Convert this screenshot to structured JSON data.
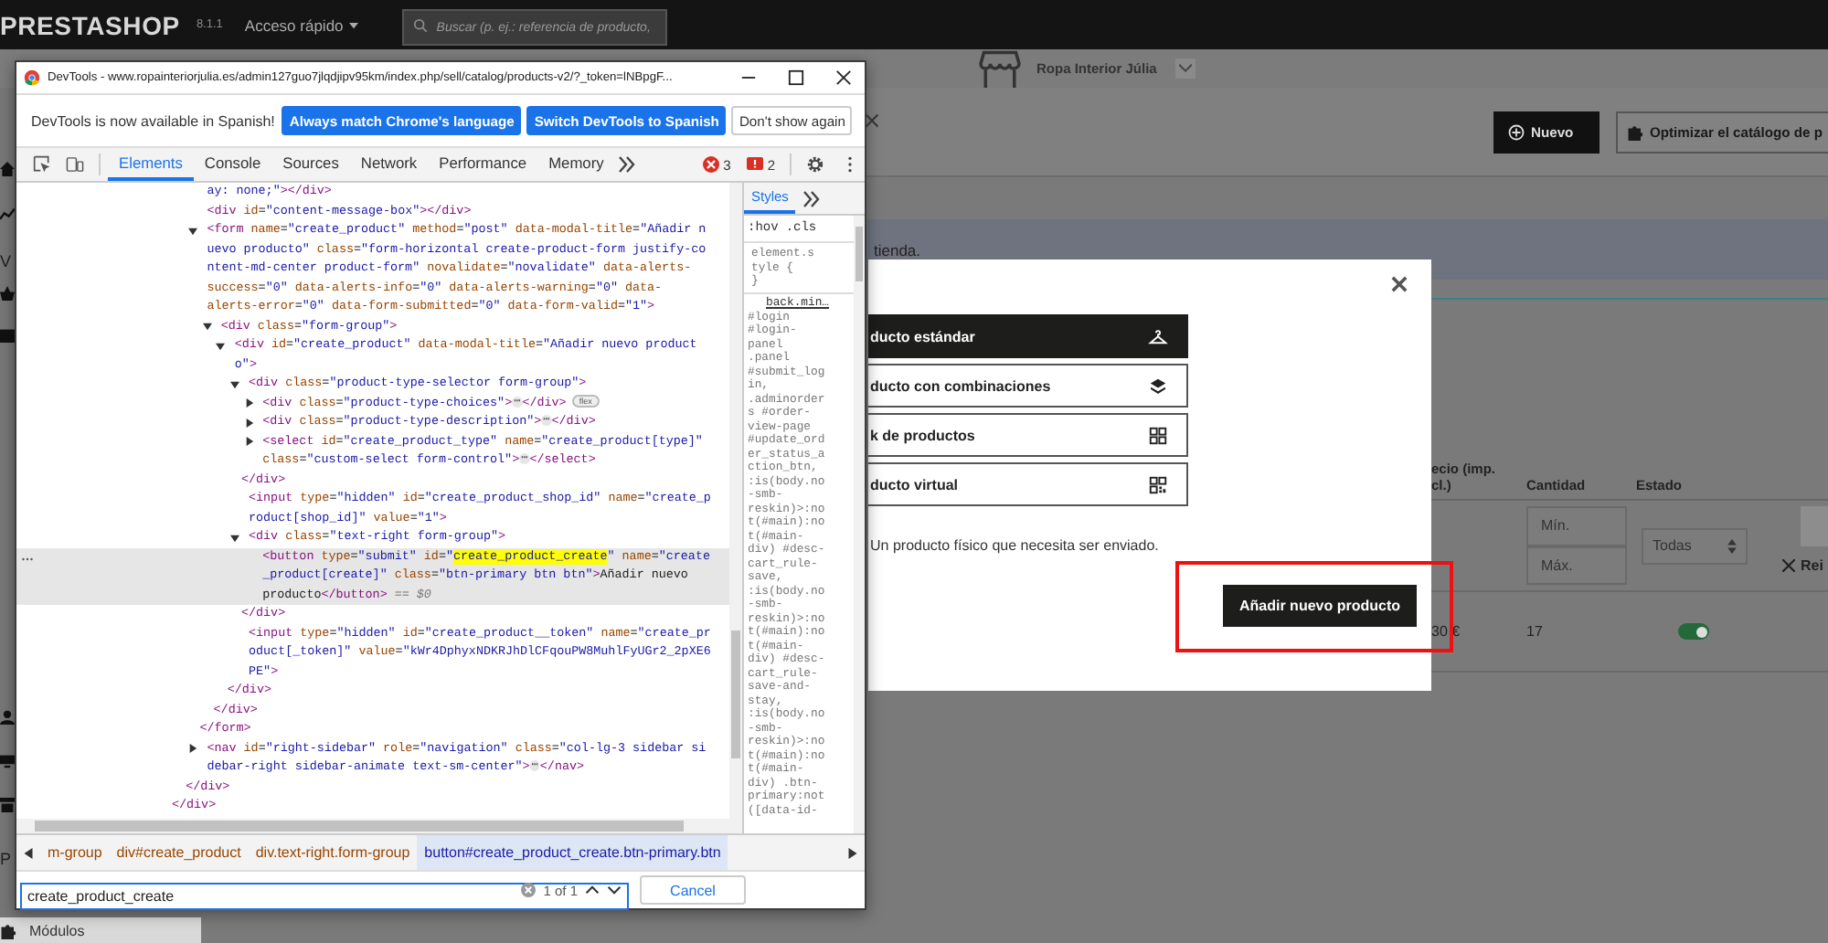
{
  "page": {
    "topbar": {
      "logo": "PRESTASHOP",
      "version": "8.1.1",
      "quick_access": "Acceso rápido",
      "search": {
        "placeholder": "Buscar (p. ej.: referencia de producto,"
      }
    },
    "shop_bar": {
      "shop_name": "Ropa Interior Júlia"
    },
    "sidebar": {
      "labels": [
        "V",
        "P"
      ],
      "bottom_item": "Módulos"
    },
    "toolbar": {
      "buttons": [
        {
          "label": "Nuevo",
          "kind": "primary"
        },
        {
          "label": "Optimizar el catálogo de p",
          "kind": "secondary"
        }
      ]
    },
    "notice": "tienda.",
    "table": {
      "columns": [
        {
          "lines": [
            "ecio (imp.",
            "cl.)"
          ]
        },
        {
          "lines": [
            "Cantidad"
          ]
        },
        {
          "lines": [
            "Estado"
          ]
        }
      ],
      "filters": {
        "min": {
          "placeholder": "Mín."
        },
        "max": {
          "placeholder": "Máx."
        },
        "status": "Todas",
        "reset": "Rei"
      },
      "rows": [
        {
          "price": "30 €",
          "quantity": "17",
          "active": true
        }
      ]
    }
  },
  "devtools": {
    "title": "DevTools - www.ropainteriorjulia.es/admin127guo7jlqdjipv95km/index.php/sell/catalog/products-v2/?_token=lNBpgF...",
    "infobar": {
      "message": "DevTools is now available in Spanish!",
      "buttons": [
        {
          "label": "Always match Chrome's language",
          "kind": "primary"
        },
        {
          "label": "Switch DevTools to Spanish",
          "kind": "primary"
        },
        {
          "label": "Don't show again",
          "kind": "plain"
        }
      ]
    },
    "tabs": [
      {
        "label": "Elements",
        "selected": true
      },
      {
        "label": "Console",
        "selected": false
      },
      {
        "label": "Sources",
        "selected": false
      },
      {
        "label": "Network",
        "selected": false
      },
      {
        "label": "Performance",
        "selected": false
      },
      {
        "label": "Memory",
        "selected": false
      }
    ],
    "errors": "3",
    "warnings": "2",
    "elements": {
      "tree": [
        {
          "close": "</div>",
          "children": [
            {
              "close": "</div>",
              "children": [
                {
                  "selected": false,
                  "lines": [
                    [
                      {
                        "text": "ay: none;\"",
                        "kind": "value"
                      },
                      "></div>"
                    ]
                  ]
                },
                {
                  "selected": false,
                  "lines": [
                    [
                      "<div id=\"content-message-box\"></div>"
                    ]
                  ]
                },
                {
                  "expanded": true,
                  "selected": false,
                  "close": "</form>",
                  "lines": [
                    [
                      "<form name=\"create_product\" method=\"post\" data-modal-title=\"Añadir n"
                    ],
                    [
                      "uevo producto\" class=\"form-horizontal create-product-form justify-co"
                    ],
                    [
                      "ntent-md-center product-form\" novalidate=\"novalidate\" data-alerts-"
                    ],
                    [
                      "success=\"0\" data-alerts-info=\"0\" data-alerts-warning=\"0\" data-"
                    ],
                    [
                      "alerts-error=\"0\" data-form-submitted=\"0\" data-form-valid=\"1\">"
                    ]
                  ],
                  "children": [
                    {
                      "expanded": true,
                      "selected": false,
                      "close": "</div>",
                      "lines": [
                        [
                          "<div class=\"form-group\">"
                        ]
                      ],
                      "children": [
                        {
                          "expanded": true,
                          "selected": false,
                          "close": "</div>",
                          "lines": [
                            [
                              "<div id=\"create_product\" data-modal-title=\"Añadir nuevo product"
                            ],
                            [
                              "o\">"
                            ]
                          ],
                          "children": [
                            {
                              "expanded": true,
                              "selected": false,
                              "close": "</div>",
                              "lines": [
                                [
                                  "<div class=\"product-type-selector form-group\">"
                                ]
                              ],
                              "children": [
                                {
                                  "expanded": false,
                                  "selected": false,
                                  "lines": [
                                    [
                                      "<div class=\"product-type-choices\">",
                                      {
                                        "text": "⋯",
                                        "kind": "ellipsis"
                                      },
                                      "</div>",
                                      {
                                        "text": "flex",
                                        "kind": "badge"
                                      }
                                    ]
                                  ]
                                },
                                {
                                  "expanded": false,
                                  "selected": false,
                                  "lines": [
                                    [
                                      "<div class=\"product-type-description\">",
                                      {
                                        "text": "⋯",
                                        "kind": "ellipsis"
                                      },
                                      "</div>"
                                    ]
                                  ]
                                },
                                {
                                  "expanded": false,
                                  "selected": false,
                                  "lines": [
                                    [
                                      "<select id=\"create_product_type\" name=\"create_product[type]\""
                                    ],
                                    [
                                      "class=\"custom-select form-control\">",
                                      {
                                        "text": "⋯",
                                        "kind": "ellipsis"
                                      },
                                      "</select>"
                                    ]
                                  ]
                                }
                              ]
                            },
                            {
                              "selected": false,
                              "lines": [
                                [
                                  "<input type=\"hidden\" id=\"create_product_shop_id\" name=\"create_p"
                                ],
                                [
                                  "roduct[shop_id]\" value=\"1\">"
                                ]
                              ]
                            },
                            {
                              "expanded": true,
                              "selected": false,
                              "close": "</div>",
                              "lines": [
                                [
                                  "<div class=\"text-right form-group\">"
                                ]
                              ],
                              "children": [
                                {
                                  "selected": true,
                                  "lines": [
                                    [
                                      "<button type=\"submit\" id=\"",
                                      {
                                        "text": "create_product_create",
                                        "kind": "match"
                                      },
                                      "\" name=\"create"
                                    ],
                                    [
                                      "_product[create]\" class=\"btn-primary btn btn\">Añadir nuevo"
                                    ],
                                    [
                                      "producto</button>",
                                      {
                                        "text": " == $0",
                                        "kind": "dim"
                                      }
                                    ]
                                  ]
                                }
                              ]
                            },
                            {
                              "selected": false,
                              "lines": [
                                [
                                  "<input type=\"hidden\" id=\"create_product__token\" name=\"create_pr"
                                ],
                                [
                                  "oduct[_token]\" value=\"kWr4DphyxNDKRJhDlCFqouPW8MuhlFyUGr2_2pXE6"
                                ],
                                [
                                  "PE\">"
                                ]
                              ]
                            }
                          ]
                        }
                      ]
                    }
                  ]
                },
                {
                  "expanded": false,
                  "selected": false,
                  "lines": [
                    [
                      "<nav id=\"right-sidebar\" role=\"navigation\" class=\"col-lg-3 sidebar si"
                    ],
                    [
                      "debar-right sidebar-animate text-sm-center\">",
                      {
                        "text": "⋯",
                        "kind": "ellipsis"
                      },
                      "</nav>"
                    ]
                  ]
                }
              ]
            }
          ]
        }
      ]
    },
    "styles": {
      "tabs": [
        {
          "label": "Styles",
          "selected": true
        }
      ],
      "filter": [
        ":hov",
        ".cls"
      ],
      "element_style": [
        "element.s",
        "tyle {",
        "}"
      ],
      "source": "back.min…",
      "selector_lines": [
        "#login",
        "#login-",
        "panel",
        ".panel",
        "#submit_log",
        "in,",
        ".adminorder",
        "s #order-",
        "view-page",
        "#update_ord",
        "er_status_a",
        "ction_btn,",
        ":is(body.no",
        "-smb-",
        "reskin)>:no",
        "t(#main):no",
        "t(#main-",
        "div) #desc-",
        "cart_rule-",
        "save,",
        ":is(body.no",
        "-smb-",
        "reskin)>:no",
        "t(#main):no",
        "t(#main-",
        "div) #desc-",
        "cart_rule-",
        "save-and-",
        "stay,",
        ":is(body.no",
        "-smb-",
        "reskin)>:no",
        "t(#main):no",
        "t(#main-",
        "div) .btn-",
        "primary:not",
        "([data-id-"
      ]
    },
    "breadcrumbs": [
      {
        "label": "m-group",
        "selected": false
      },
      {
        "label": "div#create_product",
        "selected": false
      },
      {
        "label": "div.text-right.form-group",
        "selected": false
      },
      {
        "label": "button#create_product_create.btn-primary.btn",
        "selected": true
      }
    ],
    "search": {
      "value": "create_product_create",
      "count": "1 of 1",
      "cancel": "Cancel"
    }
  },
  "modal": {
    "options": [
      {
        "label": "ducto estándar",
        "selected": true,
        "kind": "hanger"
      },
      {
        "label": "ducto con combinaciones",
        "selected": false,
        "kind": "layers"
      },
      {
        "label": "k de productos",
        "selected": false,
        "kind": "grid"
      },
      {
        "label": "ducto virtual",
        "selected": false,
        "kind": "qr"
      }
    ],
    "description": "Un producto físico que necesita ser enviado.",
    "submit": "Añadir nuevo producto"
  }
}
